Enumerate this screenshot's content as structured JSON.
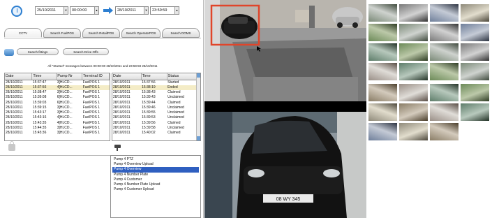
{
  "toolbar": {
    "start_date": "25/10/2011",
    "start_time": "00:00:00",
    "end_date": "28/10/2011",
    "end_time": "23:59:59"
  },
  "tabs": [
    {
      "label": "CCTV"
    },
    {
      "label": "Search FuelPOS"
    },
    {
      "label": "Search RetailPOS"
    },
    {
      "label": "Search OperatorPOS"
    },
    {
      "label": "Search DOMS"
    }
  ],
  "subtabs": [
    {
      "label": "Search fittings"
    },
    {
      "label": "Search Drive Offs"
    }
  ],
  "summary": "All \"Started\" messages between 00:00:00 28/10/2011 and 23:59:59 28/10/2011",
  "left_table": {
    "columns": [
      "Date",
      "Time",
      "Pump Nr",
      "Terminal ID"
    ],
    "rows": [
      [
        "28/10/2011",
        "15:37:47",
        "3[HLCD...",
        "FuelPOS 1"
      ],
      [
        "28/10/2011",
        "15:37:56",
        "4[HLCD...",
        "FuelPOS 1"
      ],
      [
        "28/10/2011",
        "15:38:47",
        "3[HLCD...",
        "FuelPOS 1"
      ],
      [
        "28/10/2011",
        "15:39:08",
        "6[HLCD...",
        "FuelPOS 1"
      ],
      [
        "28/10/2011",
        "15:39:03",
        "6[HLCD...",
        "FuelPOS 1"
      ],
      [
        "28/10/2011",
        "15:39:15",
        "3[HLCD...",
        "FuelPOS 1"
      ],
      [
        "28/10/2011",
        "15:43:17",
        "3[HLCD...",
        "FuelPOS 1"
      ],
      [
        "28/10/2011",
        "15:43:16",
        "4[HLCD...",
        "FuelPOS 1"
      ],
      [
        "28/10/2011",
        "15:43:35",
        "4[HLCD...",
        "FuelPOS 1"
      ],
      [
        "28/10/2011",
        "15:44:35",
        "3[HLCD...",
        "FuelPOS 1"
      ],
      [
        "28/10/2011",
        "15:45:36",
        "3[HLCD...",
        "FuelPOS 1"
      ]
    ]
  },
  "right_table": {
    "columns": [
      "Date",
      "Time",
      "Status"
    ],
    "rows": [
      [
        "28/10/2011",
        "15:37:56",
        "Started"
      ],
      [
        "28/10/2011",
        "15:38:19",
        "Ended"
      ],
      [
        "28/10/2011",
        "15:38:43",
        "Claimed"
      ],
      [
        "28/10/2011",
        "15:39:43",
        "Unclaimed"
      ],
      [
        "28/10/2011",
        "15:39:44",
        "Claimed"
      ],
      [
        "28/10/2011",
        "15:39:46",
        "Unclaimed"
      ],
      [
        "28/10/2011",
        "15:39:55",
        "Unclaimed"
      ],
      [
        "28/10/2011",
        "15:39:53",
        "Unclaimed"
      ],
      [
        "28/10/2011",
        "15:39:56",
        "Claimed"
      ],
      [
        "28/10/2011",
        "15:39:58",
        "Unclaimed"
      ],
      [
        "28/10/2011",
        "15:40:02",
        "Claimed"
      ]
    ]
  },
  "events": [
    {
      "label": "Pump 4 PTZ"
    },
    {
      "label": "Pump 4 Overview Upload"
    },
    {
      "label": "Pump 4 Overview"
    },
    {
      "label": "Pump 4 Number Plate"
    },
    {
      "label": "Pump 4 Customer"
    },
    {
      "label": "Pump 4 Number Plate Upload"
    },
    {
      "label": "Pump 4 Customer Upload"
    }
  ],
  "colors": {
    "selection": "#2f5fc0",
    "accent": "#2d7fd1",
    "highlight_box": "#e0452a"
  },
  "plate_text": "08 WY 345"
}
